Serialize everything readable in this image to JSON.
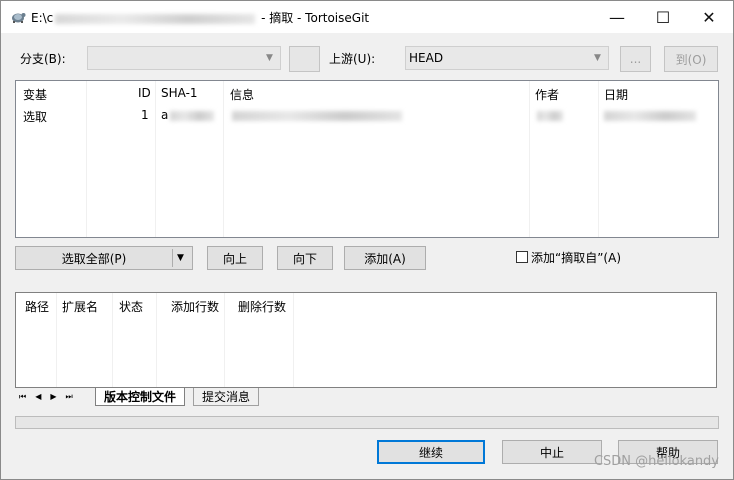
{
  "titlebar": {
    "path_prefix": "E:\\c",
    "title_suffix": " - 摘取 - TortoiseGit",
    "minimize_symbol": "—",
    "maximize_symbol": "☐",
    "close_symbol": "✕"
  },
  "branch": {
    "label": "分支(B):",
    "value": ""
  },
  "upstream": {
    "label": "上游(U):",
    "value": "HEAD",
    "browse_label": "...",
    "to_label": "到(O)"
  },
  "commit_list": {
    "columns": [
      "变基",
      "ID",
      "SHA-1",
      "信息",
      "作者",
      "日期"
    ],
    "rows": [
      {
        "action": "选取",
        "id": "1",
        "sha_prefix": "a"
      }
    ]
  },
  "actions": {
    "select_all_label": "选取全部(P)",
    "dropdown_symbol": "▼",
    "up_label": "向上",
    "down_label": "向下",
    "add_label": "添加(A)",
    "add_cherry_pick_from_label": "添加“摘取自”(A)"
  },
  "file_list": {
    "columns": [
      "路径",
      "扩展名",
      "状态",
      "添加行数",
      "删除行数"
    ]
  },
  "tabs": {
    "nav_first": "⏮",
    "nav_prev": "◀",
    "nav_next": "▶",
    "nav_last": "⏭",
    "items": [
      "版本控制文件",
      "提交消息"
    ]
  },
  "footer": {
    "continue_label": "继续",
    "abort_label": "中止",
    "help_label": "帮助",
    "watermark": "CSDN @hellokandy"
  }
}
